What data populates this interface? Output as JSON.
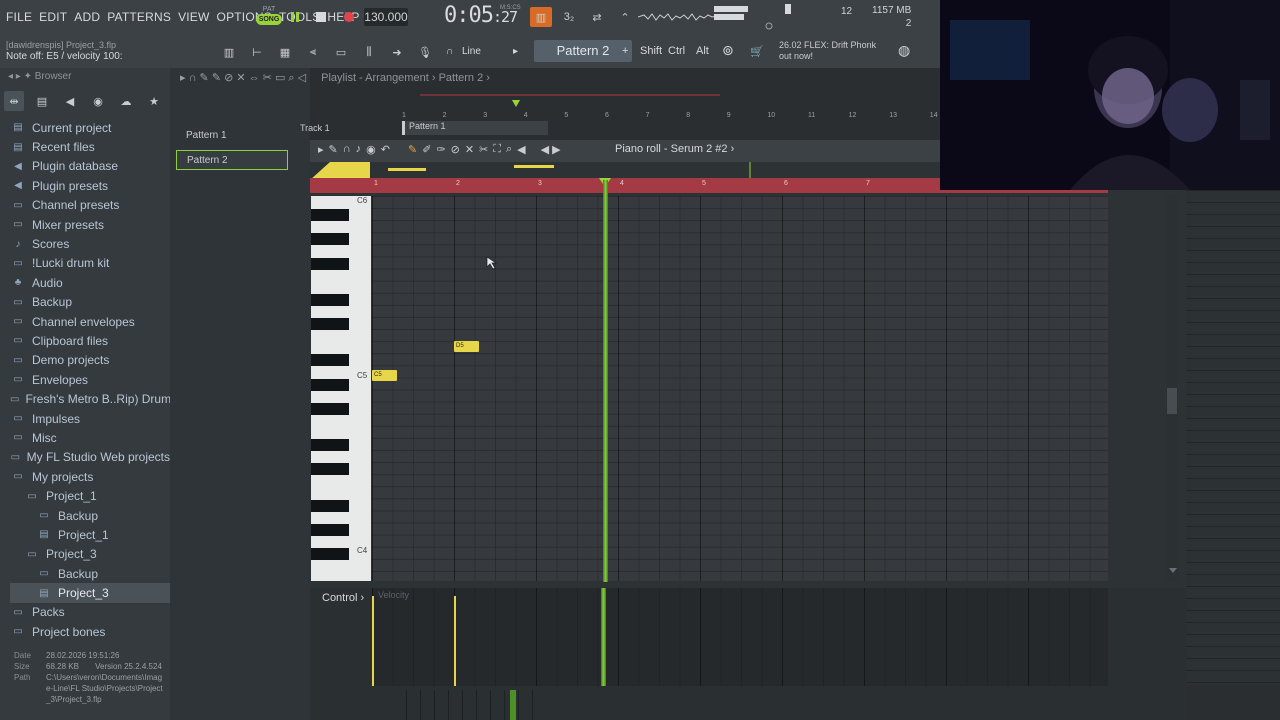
{
  "menu": [
    "FILE",
    "EDIT",
    "ADD",
    "PATTERNS",
    "VIEW",
    "OPTIONS",
    "TOOLS",
    "HELP"
  ],
  "transport": {
    "pat_label": "PAT",
    "song_label": "SONG",
    "tempo": "130.000",
    "time_main": "0:05",
    "time_small": ":27",
    "time_unit": "M:S:CS"
  },
  "monitor": {
    "cpu": "12",
    "memory": "1157 MB",
    "voices": "2"
  },
  "hint": {
    "project": "[dawidrenspis] Project_3.flp",
    "note": "Note off: E5 / velocity 100:"
  },
  "toolbar2": {
    "snap": "Line",
    "pattern": "Pattern 2",
    "shift": "Shift",
    "ctrl": "Ctrl",
    "alt": "Alt",
    "news_time": "26.02",
    "news": "FLEX: Drift Phonk out now!"
  },
  "browser": {
    "header": "Browser",
    "items": [
      {
        "label": "Current project",
        "icon": "project-icon",
        "glyph": "▤",
        "lvl": 0
      },
      {
        "label": "Recent files",
        "icon": "recent-icon",
        "glyph": "▤",
        "lvl": 0
      },
      {
        "label": "Plugin database",
        "icon": "plugin-icon",
        "glyph": "◀",
        "lvl": 0
      },
      {
        "label": "Plugin presets",
        "icon": "plugin-presets-icon",
        "glyph": "◀",
        "lvl": 0
      },
      {
        "label": "Channel presets",
        "icon": "folder-icon",
        "glyph": "▭",
        "lvl": 0
      },
      {
        "label": "Mixer presets",
        "icon": "folder-icon",
        "glyph": "▭",
        "lvl": 0
      },
      {
        "label": "Scores",
        "icon": "note-icon",
        "glyph": "♪",
        "lvl": 0
      },
      {
        "label": "!Lucki drum kit",
        "icon": "folder-icon",
        "glyph": "▭",
        "lvl": 0
      },
      {
        "label": "Audio",
        "icon": "audio-icon",
        "glyph": "♣",
        "lvl": 0
      },
      {
        "label": "Backup",
        "icon": "folder-icon",
        "glyph": "▭",
        "lvl": 0
      },
      {
        "label": "Channel envelopes",
        "icon": "folder-icon",
        "glyph": "▭",
        "lvl": 0
      },
      {
        "label": "Clipboard files",
        "icon": "folder-icon",
        "glyph": "▭",
        "lvl": 0
      },
      {
        "label": "Demo projects",
        "icon": "folder-icon",
        "glyph": "▭",
        "lvl": 0
      },
      {
        "label": "Envelopes",
        "icon": "folder-icon",
        "glyph": "▭",
        "lvl": 0
      },
      {
        "label": "Fresh's Metro B..Rip) Drum Kit",
        "icon": "folder-icon",
        "glyph": "▭",
        "lvl": 0
      },
      {
        "label": "Impulses",
        "icon": "folder-icon",
        "glyph": "▭",
        "lvl": 0
      },
      {
        "label": "Misc",
        "icon": "folder-icon",
        "glyph": "▭",
        "lvl": 0
      },
      {
        "label": "My FL Studio Web projects",
        "icon": "folder-icon",
        "glyph": "▭",
        "lvl": 0
      },
      {
        "label": "My projects",
        "icon": "folder-open-icon",
        "glyph": "▭",
        "lvl": 0
      },
      {
        "label": "Project_1",
        "icon": "folder-open-icon",
        "glyph": "▭",
        "lvl": 1
      },
      {
        "label": "Backup",
        "icon": "folder-icon",
        "glyph": "▭",
        "lvl": 2
      },
      {
        "label": "Project_1",
        "icon": "file-icon",
        "glyph": "▤",
        "lvl": 2
      },
      {
        "label": "Project_3",
        "icon": "folder-open-icon",
        "glyph": "▭",
        "lvl": 1
      },
      {
        "label": "Backup",
        "icon": "folder-icon",
        "glyph": "▭",
        "lvl": 2
      },
      {
        "label": "Project_3",
        "icon": "file-icon",
        "glyph": "▤",
        "lvl": 2,
        "selected": true
      },
      {
        "label": "Packs",
        "icon": "folder-icon",
        "glyph": "▭",
        "lvl": 0
      },
      {
        "label": "Project bones",
        "icon": "folder-icon",
        "glyph": "▭",
        "lvl": 0
      }
    ],
    "fileinfo": {
      "date_label": "Date",
      "date": "28.02.2026 19:51:26",
      "size_label": "Size",
      "size": "68.28 KB",
      "version_label": "Version",
      "version": "25.2.4.524",
      "path_label": "Path",
      "path": "C:\\Users\\veron\\Documents\\Image-Line\\FL Studio\\Projects\\Project_3\\Project_3.flp"
    }
  },
  "patterns": [
    "Pattern 1",
    "Pattern 2"
  ],
  "playlist": {
    "title": "Playlist - Arrangement",
    "pattern": "Pattern 2",
    "track": "Track 1",
    "clip": "Pattern 1",
    "ruler": [
      "1",
      "2",
      "3",
      "4",
      "5",
      "6",
      "7",
      "8",
      "9",
      "10",
      "11",
      "12",
      "13",
      "14"
    ]
  },
  "piano_roll": {
    "title": "Piano roll - Serum 2 #2",
    "ruler": [
      "1",
      "2",
      "3",
      "4",
      "5",
      "6",
      "7"
    ],
    "key_labels": [
      "C6",
      "C5",
      "C4"
    ],
    "notes": [
      {
        "label": "C5",
        "start_bar": 1.0,
        "length_beats": 1
      },
      {
        "label": "D5",
        "start_bar": 2.0,
        "length_beats": 1
      }
    ],
    "playhead_bar": 3.85
  },
  "control": {
    "label": "Control",
    "field": "Velocity"
  },
  "colors": {
    "accent_green": "#8bd13b",
    "note_yellow": "#e8d64a",
    "ruler_red": "#a43a44",
    "panel_bg": "#3b4145"
  }
}
